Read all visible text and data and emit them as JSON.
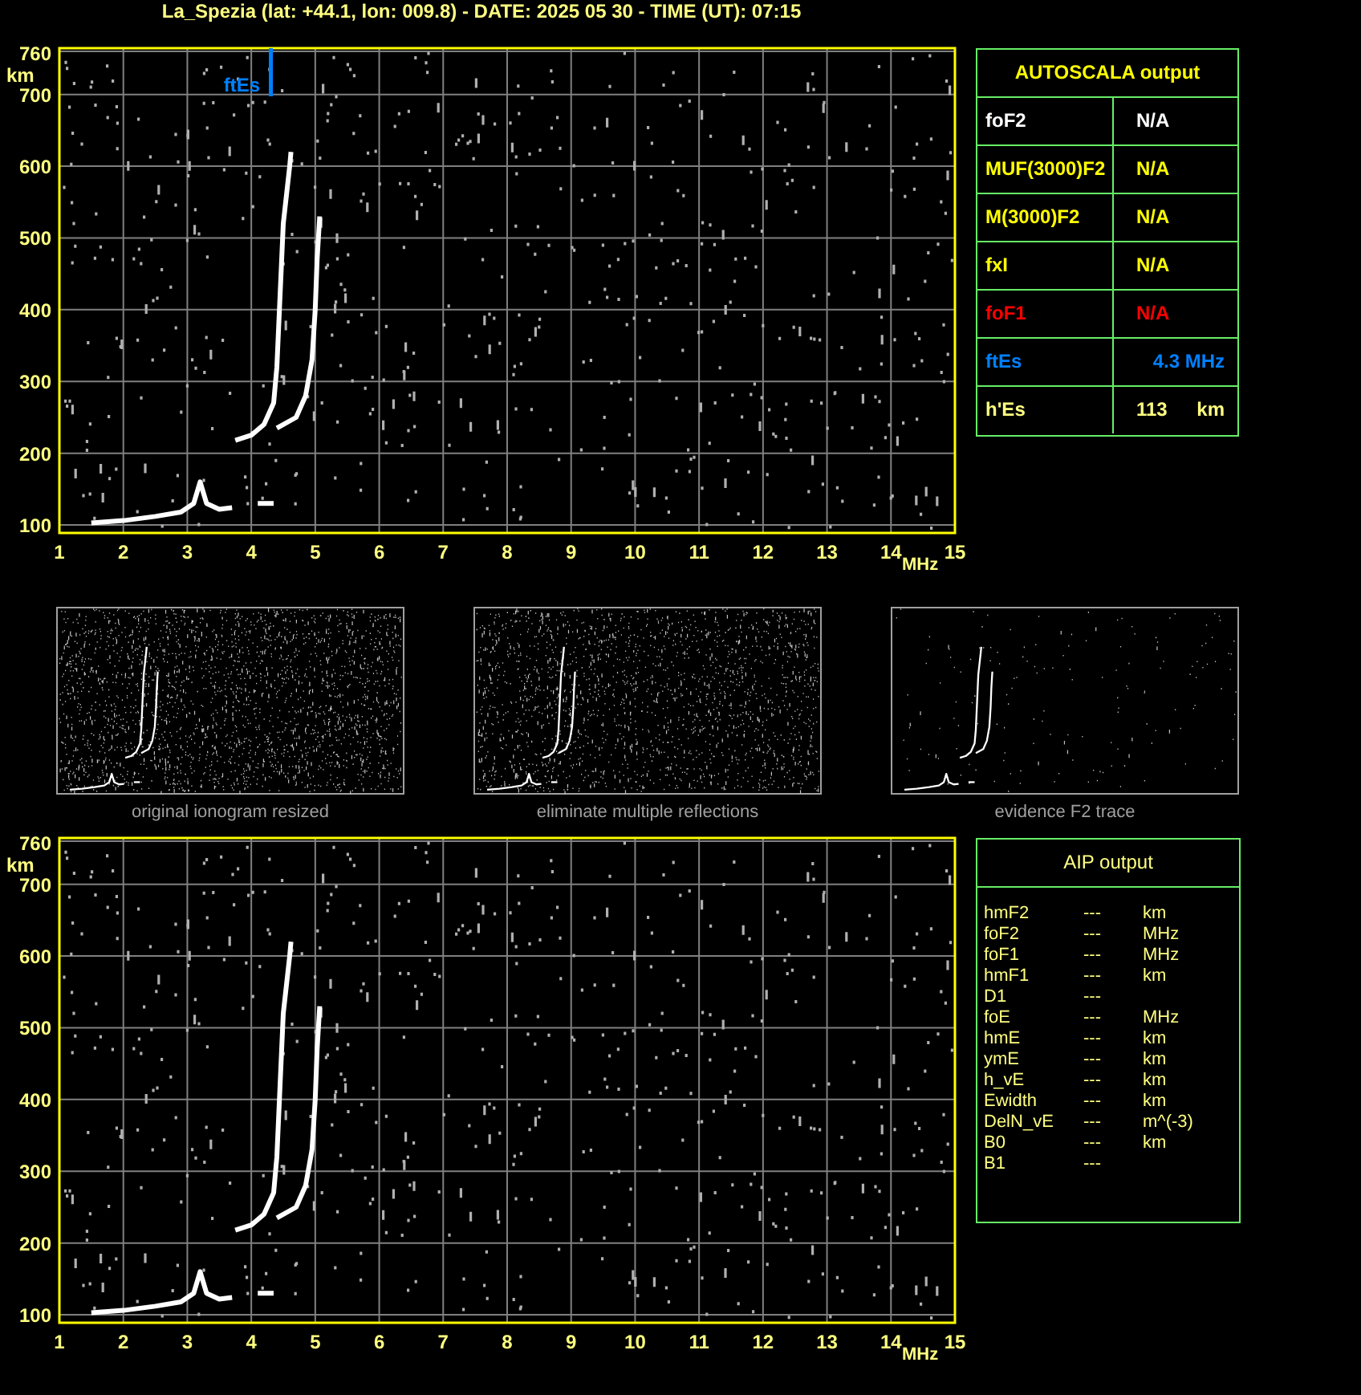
{
  "title": "La_Spezia (lat: +44.1, lon: 009.8) - DATE: 2025 05 30 - TIME (UT): 07:15",
  "ionogram": {
    "y_unit": "km",
    "y_ticks": [
      "760",
      "700",
      "600",
      "500",
      "400",
      "300",
      "200",
      "100"
    ],
    "x_ticks": [
      "1",
      "2",
      "3",
      "4",
      "5",
      "6",
      "7",
      "8",
      "9",
      "10",
      "11",
      "12",
      "13",
      "14",
      "15"
    ],
    "x_unit": "MHz",
    "marker": {
      "label": "ftEs"
    }
  },
  "autoscala": {
    "title": "AUTOSCALA output",
    "rows": [
      {
        "label": "foF2",
        "value": "N/A",
        "color": "#ffffff"
      },
      {
        "label": "MUF(3000)F2",
        "value": "N/A",
        "color": "#ffff00"
      },
      {
        "label": "M(3000)F2",
        "value": "N/A",
        "color": "#ffff00"
      },
      {
        "label": "fxI",
        "value": "N/A",
        "color": "#ffff00"
      },
      {
        "label": "foF1",
        "value": "N/A",
        "color": "#ff0000"
      },
      {
        "label": "ftEs",
        "value": "4.3 MHz",
        "color": "#0080ff"
      },
      {
        "label": "h'Es",
        "value": "113",
        "unit": "km",
        "color": "#ffff80"
      }
    ]
  },
  "thumbnails": [
    {
      "caption": "original ionogram resized",
      "kind": "original"
    },
    {
      "caption": "eliminate multiple reflections",
      "kind": "filtered"
    },
    {
      "caption": "evidence F2 trace",
      "kind": "f2"
    }
  ],
  "aip_ionogram": {
    "y_unit": "km",
    "y_ticks": [
      "760",
      "700",
      "600",
      "500",
      "400",
      "300",
      "200",
      "100"
    ],
    "x_ticks": [
      "1",
      "2",
      "3",
      "4",
      "5",
      "6",
      "7",
      "8",
      "9",
      "10",
      "11",
      "12",
      "13",
      "14",
      "15"
    ],
    "x_unit": "MHz"
  },
  "aip": {
    "title": "AIP output",
    "rows": [
      {
        "name": "hmF2",
        "value": "---",
        "unit": "km"
      },
      {
        "name": "foF2",
        "value": "---",
        "unit": "MHz"
      },
      {
        "name": "foF1",
        "value": "---",
        "unit": "MHz"
      },
      {
        "name": "hmF1",
        "value": "---",
        "unit": "km"
      },
      {
        "name": "D1",
        "value": "---"
      },
      {
        "name": "foE",
        "value": "---",
        "unit": "MHz"
      },
      {
        "name": "hmE",
        "value": "---",
        "unit": "km"
      },
      {
        "name": "ymE",
        "value": "---",
        "unit": "km"
      },
      {
        "name": "h_vE",
        "value": "---",
        "unit": "km"
      },
      {
        "name": "Ewidth",
        "value": "---",
        "unit": "km"
      },
      {
        "name": "DelN_vE",
        "value": "---",
        "unit": "m^(-3)"
      },
      {
        "name": "B0",
        "value": "---",
        "unit": "km"
      },
      {
        "name": "B1",
        "value": "---"
      }
    ]
  }
}
